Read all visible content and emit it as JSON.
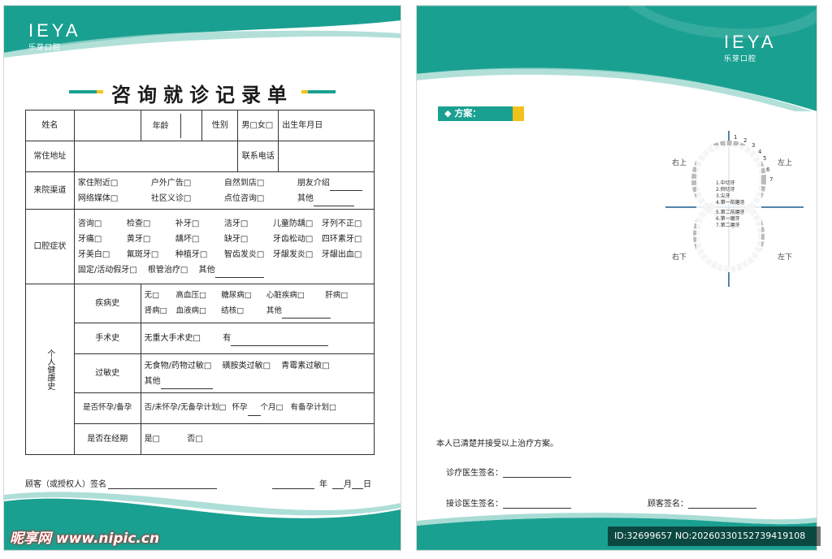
{
  "brand": {
    "mark": "EYA",
    "mark_lead": "I",
    "chinese": "乐芽口腔"
  },
  "left": {
    "title": "咨询就诊记录单",
    "rows": {
      "name": "姓名",
      "age": "年龄",
      "gender": "性别",
      "gender_opts": "男□女□",
      "dob": "出生年月日",
      "address": "常住地址",
      "phone": "联系电话",
      "channel": "来院渠道",
      "channel_opts": [
        "家住附近□",
        "户外广告□",
        "自然到店□",
        "朋友介绍",
        "网络媒体□",
        "社区义诊□",
        "点位咨询□",
        "其他"
      ],
      "symptoms": "口腔症状",
      "symptom_opts": [
        "咨询□",
        "检查□",
        "补牙□",
        "洁牙□",
        "儿童防龋□",
        "牙列不正□",
        "牙痛□",
        "黄牙□",
        "龋坏□",
        "缺牙□",
        "牙齿松动□",
        "四环素牙□",
        "牙美白□",
        "氟斑牙□",
        "种植牙□",
        "智齿发炎□",
        "牙龈发炎□",
        "牙龈出血□"
      ],
      "symptom_last": [
        "固定/活动假牙□",
        "根管治疗□",
        "其他"
      ],
      "health": "个人健康史",
      "disease": "疾病史",
      "disease_opts": [
        "无□",
        "高血压□",
        "糖尿病□",
        "心脏疾病□",
        "肝病□",
        "肾病□",
        "血液病□",
        "结核□",
        "其他"
      ],
      "surgery": "手术史",
      "surgery_opts": [
        "无重大手术史□",
        "有"
      ],
      "allergy": "过敏史",
      "allergy_opts": [
        "无食物/药物过敏□",
        "磺胺类过敏□",
        "青霉素过敏□",
        "其他"
      ],
      "pregnant": "是否怀孕/备孕",
      "pregnant_opts": [
        "否/未怀孕/无备孕计划□",
        "怀孕",
        "个月□",
        "有备孕计划□"
      ],
      "period": "是否在经期",
      "period_opts": [
        "是□",
        "否□"
      ]
    },
    "sign": "顾客（或授权人）签名",
    "date": {
      "y": "年",
      "m": "月",
      "d": "日"
    }
  },
  "right": {
    "plan": "◆ 方案：",
    "quadrants": {
      "ul": "右上",
      "ur": "左上",
      "ll": "右下",
      "lr": "左下"
    },
    "numbers": [
      "1",
      "2",
      "3",
      "4",
      "5",
      "6",
      "7"
    ],
    "legend": [
      "1.中切牙",
      "2.侧切牙",
      "3.尖牙",
      "4.第一前磨牙",
      "5.第二前磨牙",
      "6.第一磨牙",
      "7.第二磨牙"
    ],
    "consent": "本人已清楚并接受以上治疗方案。",
    "doctor_sign": "诊疗医生签名：",
    "receiver_sign": "接诊医生签名：",
    "customer_sign": "顾客签名："
  },
  "watermark": {
    "site": "昵享网 www.nipic.cn",
    "id": "ID:32699657 NO:20260330152739419108"
  },
  "colors": {
    "teal": "#1aa091",
    "yellow": "#f2c21b"
  }
}
